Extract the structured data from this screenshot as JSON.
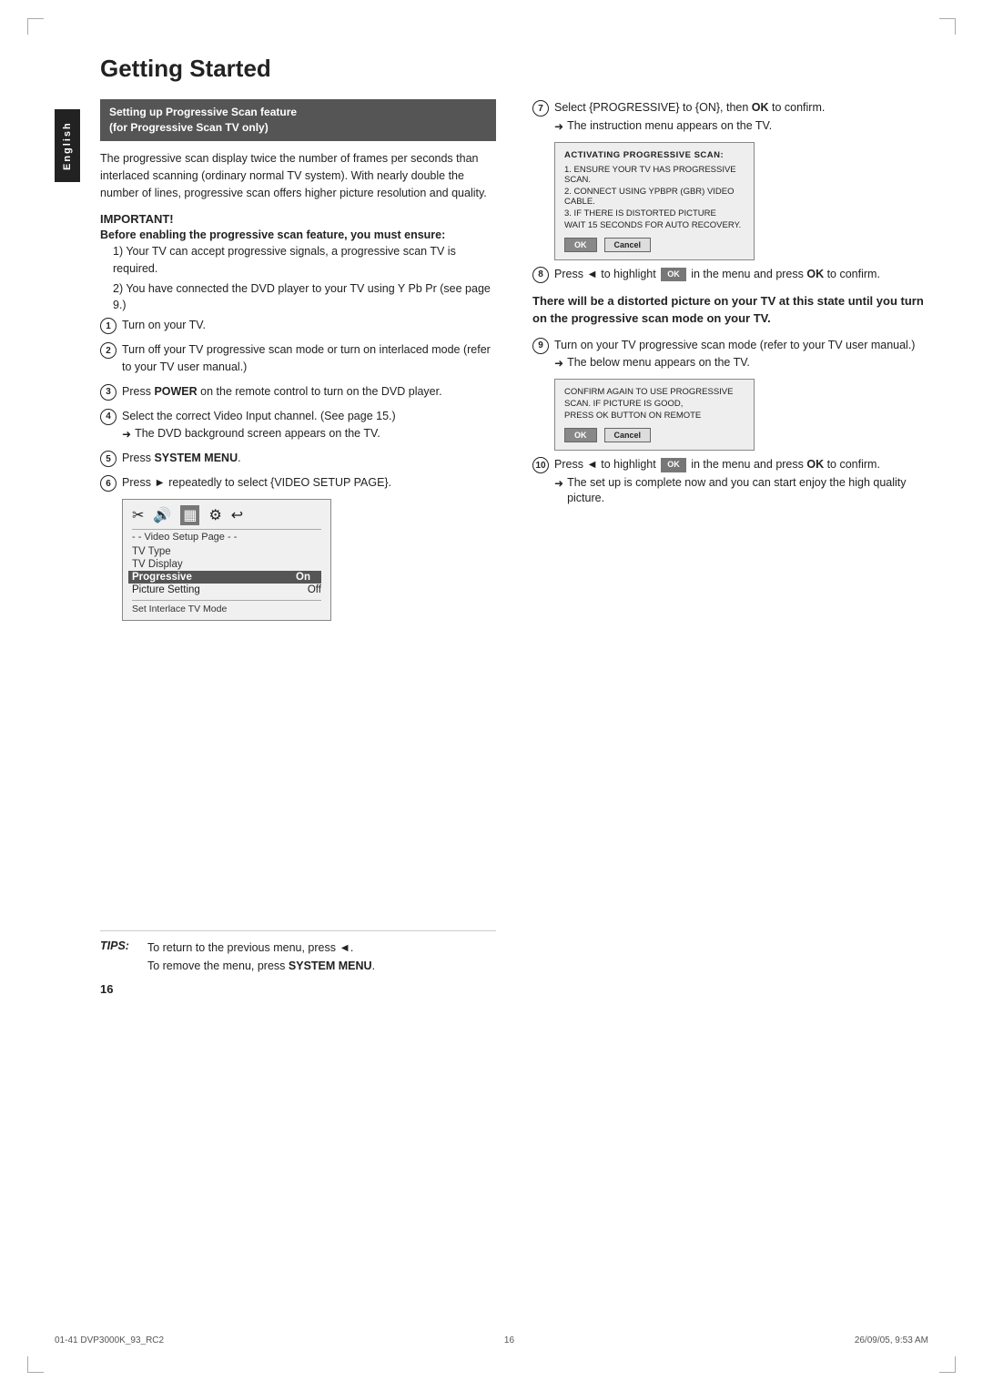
{
  "page": {
    "title": "Getting Started",
    "number": "16",
    "language_tab": "English"
  },
  "section_heading": {
    "line1": "Setting up Progressive Scan feature",
    "line2": "(for Progressive Scan TV only)"
  },
  "intro_text": "The progressive scan display twice the number of frames per seconds than interlaced scanning (ordinary normal TV system). With nearly double the number of lines, progressive scan offers higher picture resolution and quality.",
  "important": {
    "label": "IMPORTANT!",
    "bold_text": "Before enabling the progressive scan feature, you must ensure:",
    "items": [
      "1) Your TV can accept progressive signals, a progressive scan TV is required.",
      "2) You have connected the DVD player to your TV using Y Pb Pr (see page 9.)"
    ]
  },
  "steps": [
    {
      "num": "1",
      "text": "Turn on your TV."
    },
    {
      "num": "2",
      "text": "Turn off your TV progressive scan mode or turn on interlaced mode (refer to your TV user manual.)"
    },
    {
      "num": "3",
      "text": "Press POWER on the remote control to turn on the DVD player.",
      "bold": "POWER"
    },
    {
      "num": "4",
      "text": "Select the correct Video Input channel. (See page 15.)",
      "arrow_note": "The DVD background screen appears on the TV."
    },
    {
      "num": "5",
      "text": "Press SYSTEM MENU.",
      "bold": "SYSTEM MENU"
    },
    {
      "num": "6",
      "text": "Press ► repeatedly to select {VIDEO SETUP PAGE}."
    }
  ],
  "menu_box": {
    "label": "- - Video Setup Page - -",
    "items": [
      {
        "label": "TV Type",
        "value": ""
      },
      {
        "label": "TV Display",
        "value": ""
      },
      {
        "label": "Progressive",
        "value": "On",
        "highlight": true
      },
      {
        "label": "Picture Setting",
        "value": "Off"
      }
    ],
    "footer": "Set Interlace TV Mode"
  },
  "step7": {
    "num": "7",
    "text": "Select {PROGRESSIVE} to {ON}, then OK to confirm.",
    "ok_bold": "OK",
    "arrow_note": "The instruction menu appears on the TV."
  },
  "activating_box": {
    "title": "ACTIVATING PROGRESSIVE SCAN:",
    "lines": [
      "1. ENSURE YOUR TV HAS PROGRESSIVE SCAN.",
      "2. CONNECT USING YPBPR (GBR) VIDEO CABLE.",
      "3. IF THERE IS DISTORTED PICTURE",
      "WAIT 15 SECONDS FOR AUTO RECOVERY."
    ]
  },
  "step8": {
    "num": "8",
    "text": "Press ◄ to highlight",
    "ok_label": "OK",
    "text2": "in the menu and press OK to confirm.",
    "ok_bold2": "OK"
  },
  "warning_text": "There will be a distorted picture on your TV at this state until you turn on the progressive scan mode on your TV.",
  "step9": {
    "num": "9",
    "text": "Turn on your TV progressive scan mode (refer to your TV user manual.)",
    "arrow_note": "The below menu appears on the TV."
  },
  "confirm_box": {
    "lines": [
      "CONFIRM AGAIN TO USE PROGRESSIVE",
      "SCAN. IF PICTURE IS GOOD,",
      "PRESS OK BUTTON ON REMOTE"
    ]
  },
  "step10": {
    "num": "10",
    "text": "Press ◄ to highlight",
    "ok_label": "OK",
    "text2": "in the menu and press OK to confirm.",
    "ok_bold2": "OK",
    "arrow_note": "The set up is complete now and you can start enjoy the high quality picture."
  },
  "tips": {
    "label": "TIPS:",
    "line1": "To return to the previous menu, press ◄.",
    "line2": "To remove the menu, press SYSTEM MENU.",
    "system_menu_bold": "SYSTEM MENU"
  },
  "footer": {
    "left": "01-41 DVP3000K_93_RC2",
    "center": "16",
    "right": "26/09/05, 9:53 AM"
  }
}
